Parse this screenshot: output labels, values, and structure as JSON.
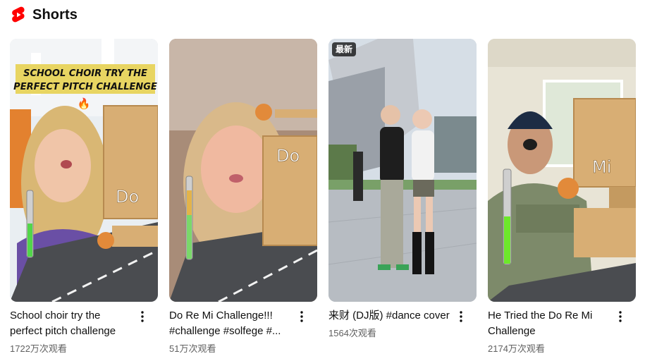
{
  "shelf": {
    "title": "Shorts",
    "logo_icon": "youtube-shorts-logo",
    "brand_color": "#ff0000"
  },
  "shorts": [
    {
      "title": "School choir try the perfect pitch challenge",
      "views": "1722万次观看",
      "overlay_banner": [
        "SCHOOL CHOIR TRY THE",
        "PERFECT PITCH CHALLENGE"
      ],
      "overlay_emoji": "🔥",
      "door_label": "Do",
      "menu_icon": "more-vertical-icon",
      "meter_level": 0.45
    },
    {
      "title": "Do Re Mi Challenge!!! #challenge #solfege #...",
      "views": "51万次观看",
      "door_label": "Do",
      "menu_icon": "more-vertical-icon",
      "meter_level": 0.55
    },
    {
      "title": "来财 (DJ版) #dance cover",
      "views": "1564次观看",
      "badge": "最新",
      "menu_icon": "more-vertical-icon"
    },
    {
      "title": "He Tried the Do Re Mi Challenge",
      "views": "2174万次观看",
      "door_label": "Mi",
      "menu_icon": "more-vertical-icon",
      "meter_level": 0.5
    }
  ]
}
